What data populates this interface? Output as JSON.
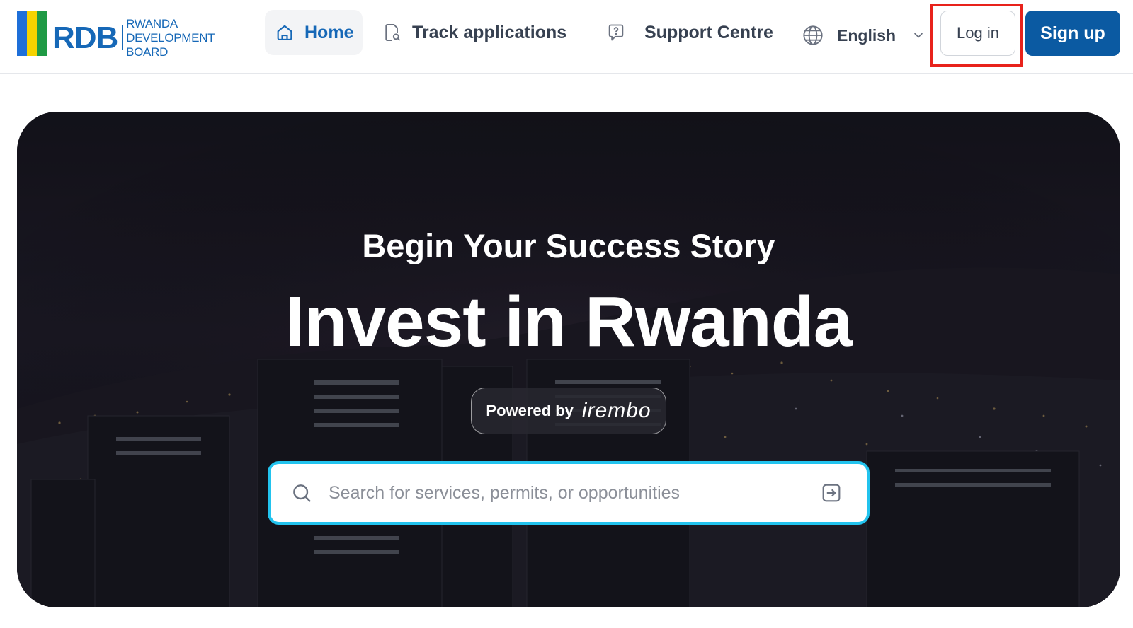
{
  "header": {
    "logo": {
      "abbr": "RDB",
      "line1": "RWANDA",
      "line2": "DEVELOPMENT BOARD",
      "flag_colors": [
        "#1e6fd9",
        "#f5d300",
        "#1f9a45"
      ]
    },
    "nav": [
      {
        "label": "Home",
        "icon": "home-icon",
        "active": true
      },
      {
        "label": "Track applications",
        "icon": "document-search-icon",
        "active": false
      },
      {
        "label": "Support Centre",
        "icon": "help-bubble-icon",
        "active": false
      }
    ],
    "language": {
      "selected": "English",
      "icon": "globe-icon"
    },
    "login_label": "Log in",
    "signup_label": "Sign up"
  },
  "hero": {
    "subtitle": "Begin Your Success Story",
    "title": "Invest in Rwanda",
    "powered_by": {
      "label": "Powered by",
      "brand": "irembo"
    },
    "search": {
      "placeholder": "Search for services, permits, or opportunities",
      "value": ""
    }
  },
  "colors": {
    "brand_blue": "#0b5aa2",
    "logo_blue": "#1668b7",
    "search_border": "#22c3ee",
    "highlight_red": "#e8221b"
  }
}
